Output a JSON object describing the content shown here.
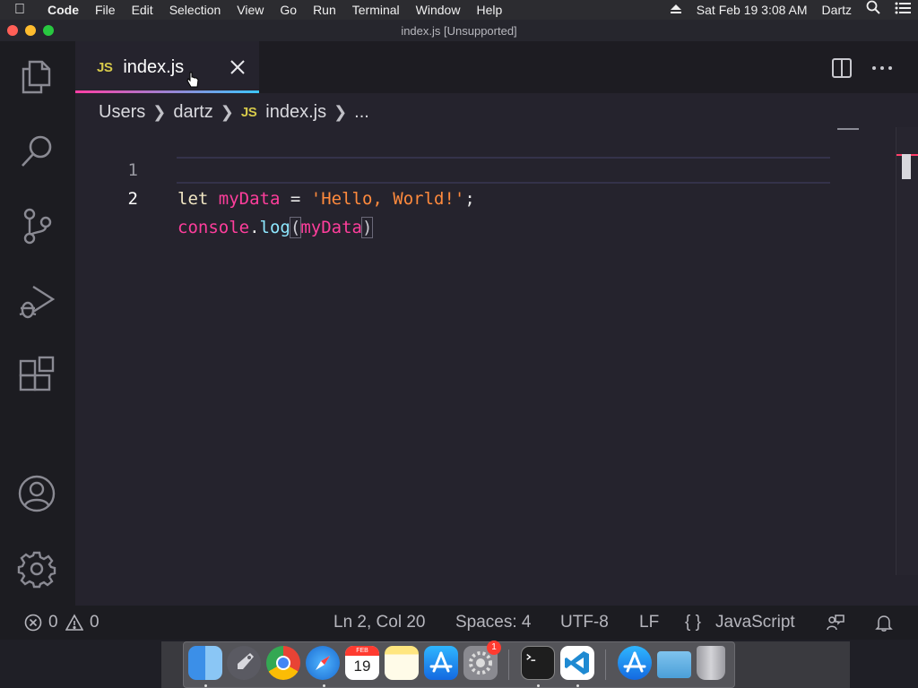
{
  "menubar": {
    "apple_icon": "apple-icon",
    "app_name": "Code",
    "items": [
      "File",
      "Edit",
      "Selection",
      "View",
      "Go",
      "Run",
      "Terminal",
      "Window",
      "Help"
    ],
    "datetime": "Sat Feb 19  3:08 AM",
    "user": "Dartz"
  },
  "window": {
    "title": "index.js [Unsupported]"
  },
  "activity_bar": {
    "icons": [
      "explorer-icon",
      "search-icon",
      "source-control-icon",
      "run-debug-icon",
      "extensions-icon",
      "accounts-icon",
      "settings-gear-icon"
    ]
  },
  "tab": {
    "badge": "JS",
    "label": "index.js"
  },
  "breadcrumb": {
    "parts": [
      "Users",
      "dartz"
    ],
    "file_badge": "JS",
    "file": "index.js",
    "more": "..."
  },
  "code": {
    "line_numbers": [
      "1",
      "2"
    ],
    "line1": {
      "kw": "let",
      "var": "myData",
      "op": "=",
      "str": "'Hello, World!'",
      "end": ";"
    },
    "line2": {
      "obj": "console",
      "dot": ".",
      "fn": "log",
      "open": "(",
      "arg": "myData",
      "close": ")"
    }
  },
  "statusbar": {
    "errors": "0",
    "warnings": "0",
    "position": "Ln 2, Col 20",
    "spaces": "Spaces: 4",
    "encoding": "UTF-8",
    "eol": "LF",
    "language_icon": "{ }",
    "language": "JavaScript"
  },
  "dock": {
    "calendar_month": "FEB",
    "calendar_day": "19",
    "settings_badge": "1",
    "apps": [
      "finder-icon",
      "launchpad-icon",
      "chrome-icon",
      "safari-icon",
      "calendar-icon",
      "notes-icon",
      "app-store-icon",
      "system-preferences-icon",
      "terminal-icon",
      "vscode-icon",
      "app-store-downloads-icon",
      "downloads-folder-icon",
      "trash-icon"
    ]
  },
  "colors": {
    "accent_pink": "#ff3e9c",
    "accent_cyan": "#3cc6ff",
    "string_orange": "#ff8a3d",
    "editor_bg": "#25232d"
  }
}
